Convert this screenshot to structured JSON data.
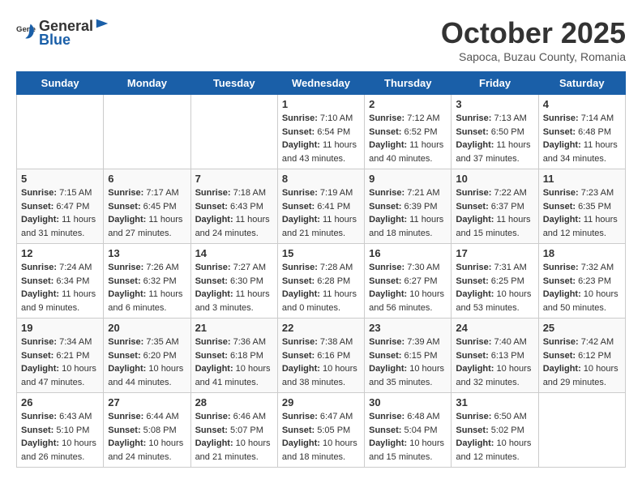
{
  "header": {
    "logo_general": "General",
    "logo_blue": "Blue",
    "month": "October 2025",
    "location": "Sapoca, Buzau County, Romania"
  },
  "weekdays": [
    "Sunday",
    "Monday",
    "Tuesday",
    "Wednesday",
    "Thursday",
    "Friday",
    "Saturday"
  ],
  "weeks": [
    [
      {
        "day": "",
        "info": ""
      },
      {
        "day": "",
        "info": ""
      },
      {
        "day": "",
        "info": ""
      },
      {
        "day": "1",
        "info": "Sunrise: 7:10 AM\nSunset: 6:54 PM\nDaylight: 11 hours and 43 minutes."
      },
      {
        "day": "2",
        "info": "Sunrise: 7:12 AM\nSunset: 6:52 PM\nDaylight: 11 hours and 40 minutes."
      },
      {
        "day": "3",
        "info": "Sunrise: 7:13 AM\nSunset: 6:50 PM\nDaylight: 11 hours and 37 minutes."
      },
      {
        "day": "4",
        "info": "Sunrise: 7:14 AM\nSunset: 6:48 PM\nDaylight: 11 hours and 34 minutes."
      }
    ],
    [
      {
        "day": "5",
        "info": "Sunrise: 7:15 AM\nSunset: 6:47 PM\nDaylight: 11 hours and 31 minutes."
      },
      {
        "day": "6",
        "info": "Sunrise: 7:17 AM\nSunset: 6:45 PM\nDaylight: 11 hours and 27 minutes."
      },
      {
        "day": "7",
        "info": "Sunrise: 7:18 AM\nSunset: 6:43 PM\nDaylight: 11 hours and 24 minutes."
      },
      {
        "day": "8",
        "info": "Sunrise: 7:19 AM\nSunset: 6:41 PM\nDaylight: 11 hours and 21 minutes."
      },
      {
        "day": "9",
        "info": "Sunrise: 7:21 AM\nSunset: 6:39 PM\nDaylight: 11 hours and 18 minutes."
      },
      {
        "day": "10",
        "info": "Sunrise: 7:22 AM\nSunset: 6:37 PM\nDaylight: 11 hours and 15 minutes."
      },
      {
        "day": "11",
        "info": "Sunrise: 7:23 AM\nSunset: 6:35 PM\nDaylight: 11 hours and 12 minutes."
      }
    ],
    [
      {
        "day": "12",
        "info": "Sunrise: 7:24 AM\nSunset: 6:34 PM\nDaylight: 11 hours and 9 minutes."
      },
      {
        "day": "13",
        "info": "Sunrise: 7:26 AM\nSunset: 6:32 PM\nDaylight: 11 hours and 6 minutes."
      },
      {
        "day": "14",
        "info": "Sunrise: 7:27 AM\nSunset: 6:30 PM\nDaylight: 11 hours and 3 minutes."
      },
      {
        "day": "15",
        "info": "Sunrise: 7:28 AM\nSunset: 6:28 PM\nDaylight: 11 hours and 0 minutes."
      },
      {
        "day": "16",
        "info": "Sunrise: 7:30 AM\nSunset: 6:27 PM\nDaylight: 10 hours and 56 minutes."
      },
      {
        "day": "17",
        "info": "Sunrise: 7:31 AM\nSunset: 6:25 PM\nDaylight: 10 hours and 53 minutes."
      },
      {
        "day": "18",
        "info": "Sunrise: 7:32 AM\nSunset: 6:23 PM\nDaylight: 10 hours and 50 minutes."
      }
    ],
    [
      {
        "day": "19",
        "info": "Sunrise: 7:34 AM\nSunset: 6:21 PM\nDaylight: 10 hours and 47 minutes."
      },
      {
        "day": "20",
        "info": "Sunrise: 7:35 AM\nSunset: 6:20 PM\nDaylight: 10 hours and 44 minutes."
      },
      {
        "day": "21",
        "info": "Sunrise: 7:36 AM\nSunset: 6:18 PM\nDaylight: 10 hours and 41 minutes."
      },
      {
        "day": "22",
        "info": "Sunrise: 7:38 AM\nSunset: 6:16 PM\nDaylight: 10 hours and 38 minutes."
      },
      {
        "day": "23",
        "info": "Sunrise: 7:39 AM\nSunset: 6:15 PM\nDaylight: 10 hours and 35 minutes."
      },
      {
        "day": "24",
        "info": "Sunrise: 7:40 AM\nSunset: 6:13 PM\nDaylight: 10 hours and 32 minutes."
      },
      {
        "day": "25",
        "info": "Sunrise: 7:42 AM\nSunset: 6:12 PM\nDaylight: 10 hours and 29 minutes."
      }
    ],
    [
      {
        "day": "26",
        "info": "Sunrise: 6:43 AM\nSunset: 5:10 PM\nDaylight: 10 hours and 26 minutes."
      },
      {
        "day": "27",
        "info": "Sunrise: 6:44 AM\nSunset: 5:08 PM\nDaylight: 10 hours and 24 minutes."
      },
      {
        "day": "28",
        "info": "Sunrise: 6:46 AM\nSunset: 5:07 PM\nDaylight: 10 hours and 21 minutes."
      },
      {
        "day": "29",
        "info": "Sunrise: 6:47 AM\nSunset: 5:05 PM\nDaylight: 10 hours and 18 minutes."
      },
      {
        "day": "30",
        "info": "Sunrise: 6:48 AM\nSunset: 5:04 PM\nDaylight: 10 hours and 15 minutes."
      },
      {
        "day": "31",
        "info": "Sunrise: 6:50 AM\nSunset: 5:02 PM\nDaylight: 10 hours and 12 minutes."
      },
      {
        "day": "",
        "info": ""
      }
    ]
  ]
}
